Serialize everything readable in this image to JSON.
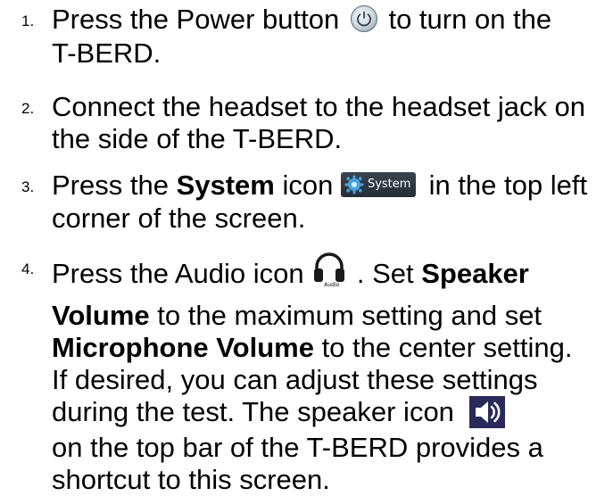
{
  "steps": [
    {
      "number": "1.",
      "lines": [
        [
          "Press the Power button ",
          "",
          " to turn on the"
        ],
        [
          "T-BERD."
        ]
      ]
    },
    {
      "number": "2.",
      "lines": [
        [
          "Connect the headset to the headset jack on"
        ],
        [
          "the side of the T-BERD."
        ]
      ]
    },
    {
      "number": "3.",
      "lines": [
        [
          "Press the ",
          "System",
          " icon ",
          "",
          "  in the top left"
        ],
        [
          "corner of the screen."
        ]
      ]
    },
    {
      "number": "4.",
      "lines": [
        [
          "Press the Audio icon ",
          "",
          " .  Set ",
          "Speaker"
        ],
        [
          "Volume",
          " to the maximum setting and set"
        ],
        [
          "Microphone Volume",
          " to the center setting."
        ],
        [
          "If desired, you can adjust these settings"
        ],
        [
          "during the test.  The speaker icon "
        ],
        [
          "on the top bar of the T-BERD provides a"
        ],
        [
          "shortcut to this screen."
        ]
      ]
    }
  ],
  "icons": {
    "power": "power-button-icon",
    "system": "system-gear-icon",
    "system_label": "System",
    "audio": "headphones-icon",
    "audio_label": "Audio",
    "speaker": "speaker-volume-icon"
  },
  "colors": {
    "text": "#000000",
    "system_bar": "#2f3741",
    "gear": "#4aa3df",
    "speaker_bg": "#2a2a5a"
  }
}
